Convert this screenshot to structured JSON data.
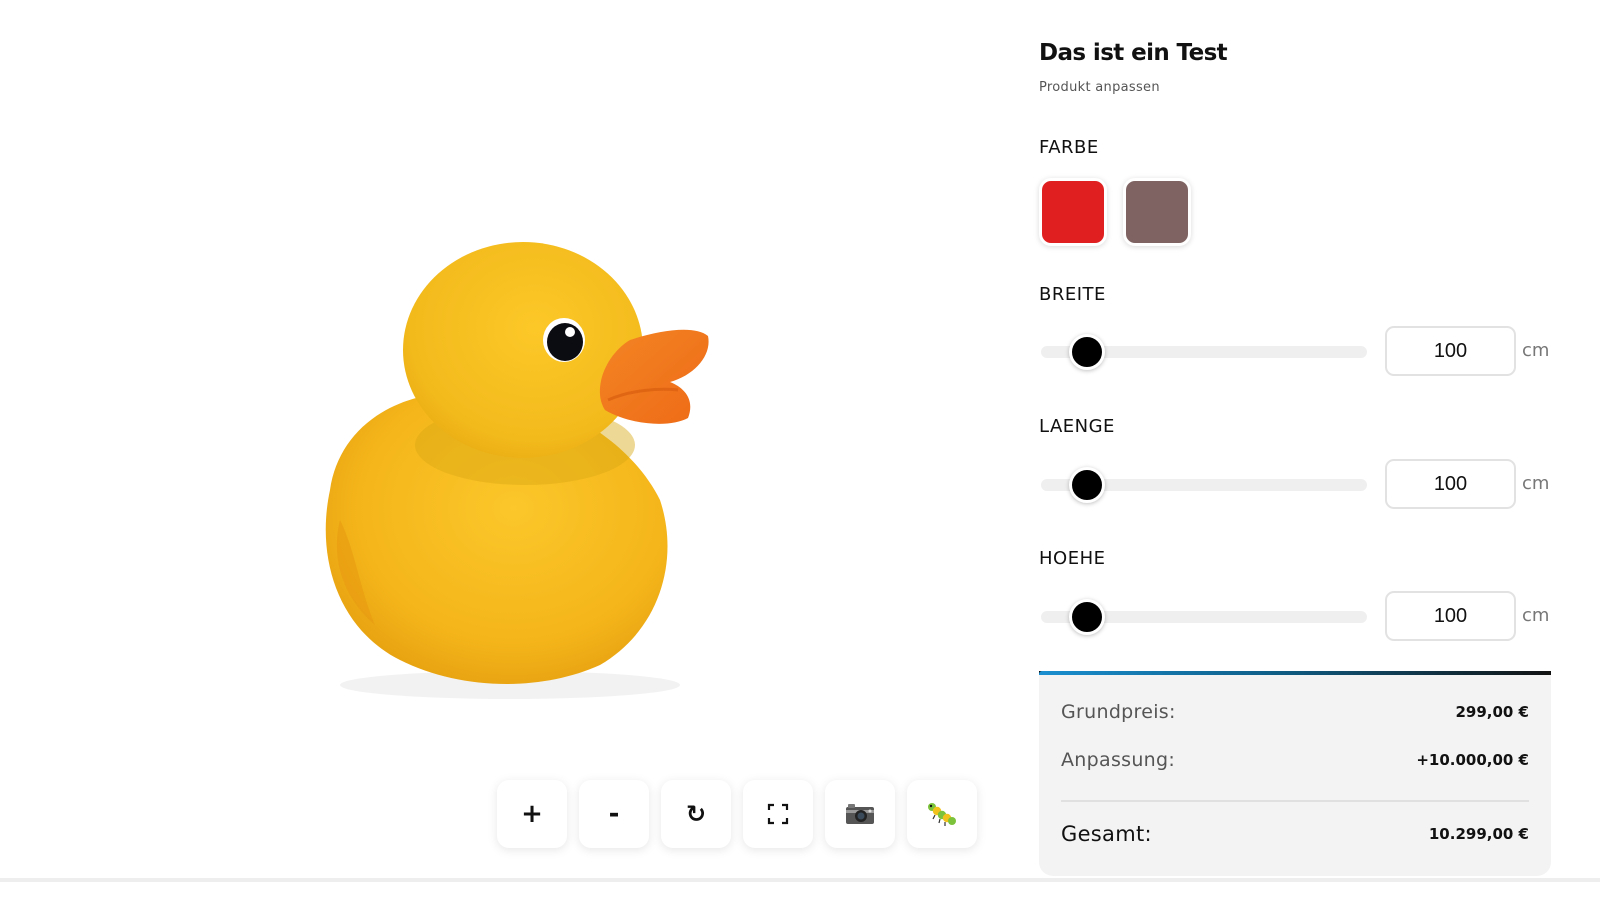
{
  "product": {
    "title": "Das ist ein Test",
    "subtitle": "Produkt anpassen"
  },
  "farbe": {
    "label": "FARBE",
    "options": [
      {
        "name": "red",
        "color": "#e02020"
      },
      {
        "name": "taupe",
        "color": "#7f6363"
      }
    ]
  },
  "dimensions": [
    {
      "key": "breite",
      "label": "BREITE",
      "value": "100",
      "unit": "cm",
      "slider_fraction": 0.14
    },
    {
      "key": "laenge",
      "label": "LAENGE",
      "value": "100",
      "unit": "cm",
      "slider_fraction": 0.14
    },
    {
      "key": "hoehe",
      "label": "HOEHE",
      "value": "100",
      "unit": "cm",
      "slider_fraction": 0.14
    }
  ],
  "pricing": {
    "base_label": "Grundpreis:",
    "base_value": "299,00 €",
    "adjust_label": "Anpassung:",
    "adjust_value": "+10.000,00 €",
    "total_label": "Gesamt:",
    "total_value": "10.299,00 €"
  },
  "toolbar": {
    "zoom_in": "+",
    "zoom_out": "-",
    "reset": "↻",
    "fullscreen_icon": "fullscreen-icon",
    "screenshot_icon": "camera-icon",
    "debug_icon": "bug-icon"
  },
  "colors": {
    "duck_body": "#f5b81c",
    "duck_beak": "#f07a1e",
    "price_accent": "#1a8fd0"
  }
}
